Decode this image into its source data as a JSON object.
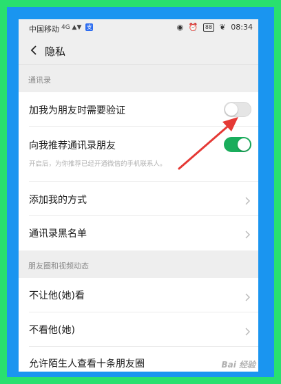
{
  "status_bar": {
    "carrier": "中国移动",
    "signal": "4G ▲▼",
    "app_badge": "支",
    "battery": "88",
    "time": "08:34"
  },
  "header": {
    "title": "隐私"
  },
  "sections": [
    {
      "title": "通讯录"
    },
    {
      "title": "朋友圈和视频动态"
    }
  ],
  "rows": {
    "verify_friend": {
      "label": "加我为朋友时需要验证",
      "toggle": "off"
    },
    "recommend_contacts": {
      "label": "向我推荐通讯录朋友",
      "toggle": "on",
      "sub": "开启后，为你推荐已经开通微信的手机联系人。"
    },
    "add_method": {
      "label": "添加我的方式"
    },
    "blacklist": {
      "label": "通讯录黑名单"
    },
    "dont_let_see": {
      "label": "不让他(她)看"
    },
    "dont_see": {
      "label": "不看他(她)"
    },
    "strangers_moments": {
      "label": "允许陌生人查看十条朋友圈"
    }
  },
  "colors": {
    "outer_border": "#29e06f",
    "inner_border": "#1a95f0",
    "toggle_on": "#1aad5c",
    "arrow": "#e53935"
  },
  "watermark": "Bai 经验"
}
